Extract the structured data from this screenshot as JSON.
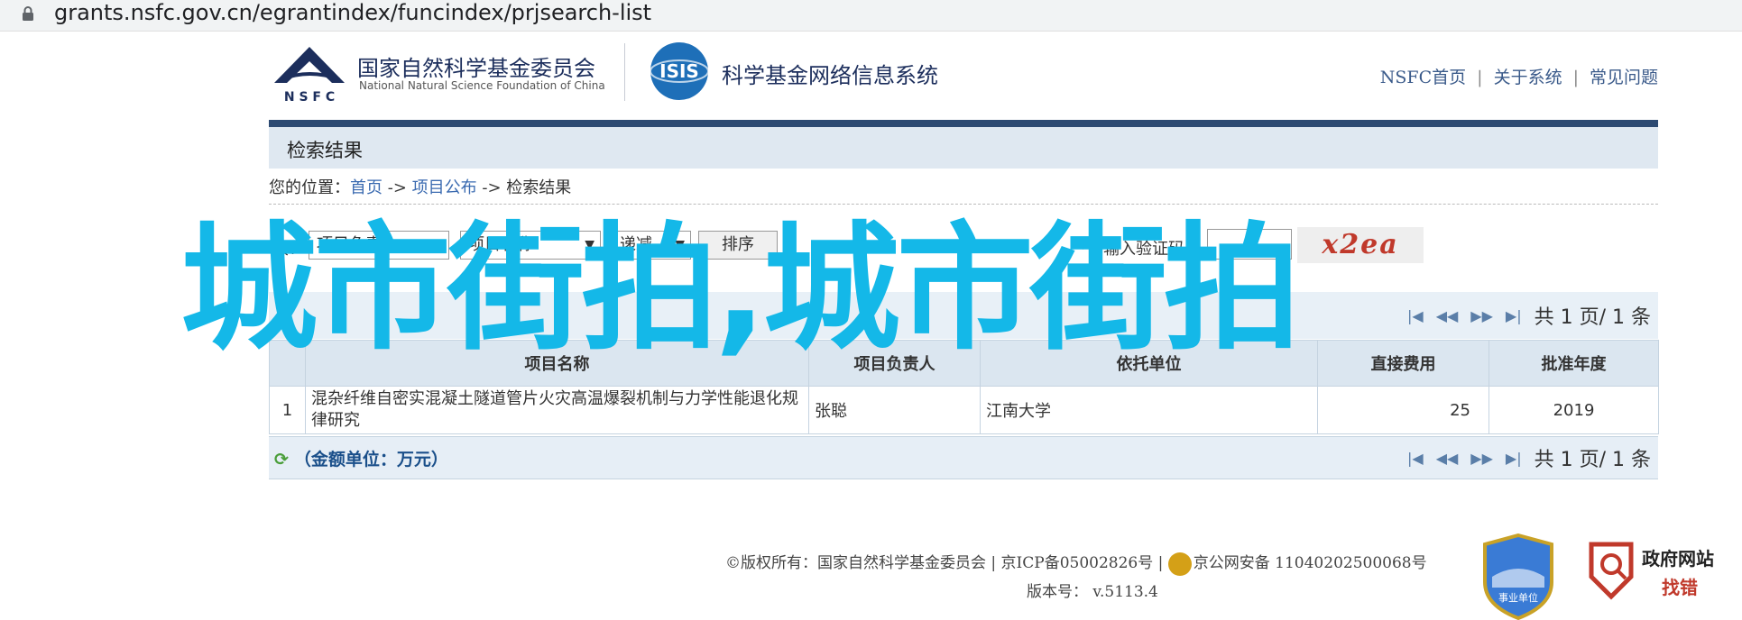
{
  "browser": {
    "url": "grants.nsfc.gov.cn/egrantindex/funcindex/prjsearch-list"
  },
  "header": {
    "nsfc_abbr": "N S F C",
    "nsfc_cn": "国家自然科学基金委员会",
    "nsfc_en": "National Natural Science Foundation of China",
    "isis_text": "ISIS",
    "isis_title": "科学基金网络信息系统",
    "links": [
      "NSFC首页",
      "关于系统",
      "常见问题"
    ]
  },
  "section_title": "检索结果",
  "breadcrumb": {
    "prefix": "您的位置：",
    "home": "首页",
    "arrow": "->",
    "project": "项目公布",
    "current": "检索结果"
  },
  "form": {
    "sort_label": "按：",
    "sort_field_1": "项目负责人",
    "sort_field_2": "项目名称",
    "sort_order": "递减",
    "sort_button": "排序",
    "captcha_star": "*",
    "captcha_label": "请输入验证码:",
    "captcha_value": "",
    "captcha_image_text": "x2ea"
  },
  "pager": {
    "text": "共 1 页/ 1 条"
  },
  "table": {
    "headers": [
      "",
      "项目名称",
      "项目负责人",
      "依托单位",
      "直接费用",
      "批准年度"
    ],
    "rows": [
      {
        "index": "1",
        "name": "混杂纤维自密实混凝土隧道管片火灾高温爆裂机制与力学性能退化规律研究",
        "leader": "张聪",
        "org": "江南大学",
        "cost": "25",
        "year": "2019"
      }
    ]
  },
  "unit_note": "（金额单位：万元）",
  "overlay_text": "城市街拍,城市街拍",
  "footer": {
    "copyright": "©版权所有：国家自然科学基金委员会 | 京ICP备05002826号 | ",
    "police": "京公网安备 11040202500068号",
    "version": "版本号：  v.5113.4",
    "shield_text": "事业单位",
    "gov_line1": "政府网站",
    "gov_line2": "找错"
  },
  "colors": {
    "accent": "#2d4a72",
    "overlay": "#14b8e8",
    "link": "#3a6ab0"
  }
}
